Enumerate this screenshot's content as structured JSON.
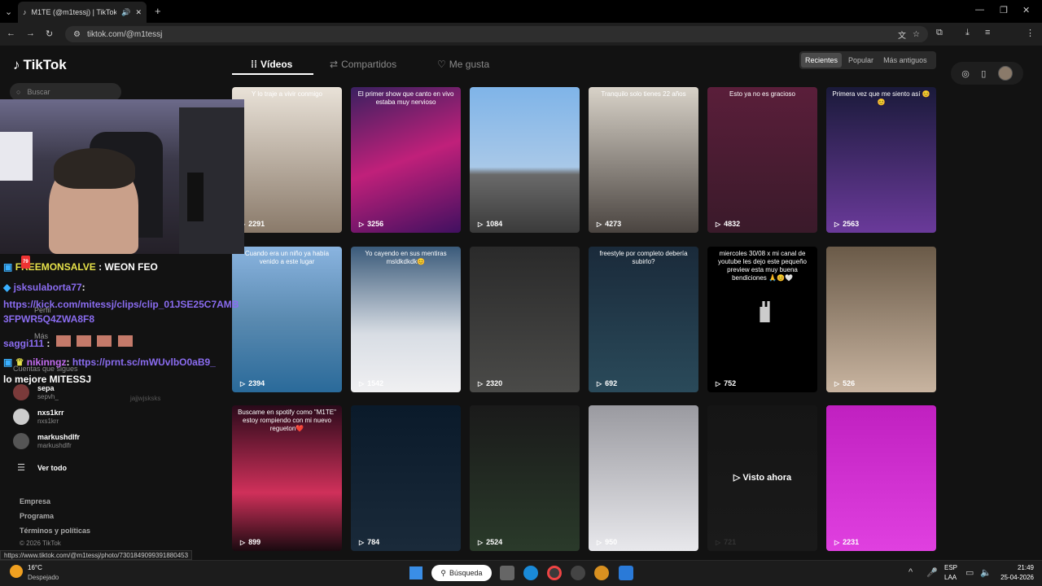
{
  "browser": {
    "tab_title": "M1TE (@m1tessj) | TikTok",
    "url": "tiktok.com/@m1tessj"
  },
  "tiktok": {
    "logo": "TikTok",
    "search_placeholder": "Buscar",
    "tabs": [
      "Vídeos",
      "Compartidos",
      "Me gusta"
    ],
    "sort": [
      "Recientes",
      "Popular",
      "Más antiguos"
    ],
    "avatar_letter": "M"
  },
  "videos": [
    {
      "caption": "Y lo traje a vivir conmigo",
      "views": "2291"
    },
    {
      "caption": "El primer show que canto en vivo estaba muy nervioso",
      "views": "3256"
    },
    {
      "caption": "",
      "views": "1084"
    },
    {
      "caption": "Tranquilo solo tienes 22 años",
      "views": "4273"
    },
    {
      "caption": "Esto ya no es gracioso",
      "views": "4832"
    },
    {
      "caption": "Primera vez que me siento así 😊😊",
      "views": "2563"
    },
    {
      "caption": "Cuando era un niño ya había venido a este lugar",
      "views": "2394"
    },
    {
      "caption": "Yo cayendo en sus mentiras msldkdkdk😊",
      "views": "1542"
    },
    {
      "caption": "",
      "views": "2320"
    },
    {
      "caption": "freestyle por completo debería subirlo?",
      "views": "692"
    },
    {
      "caption": "miercoles 30/08 x mi canal de youtube les dejo este pequeño preview esta muy buena bendiciones 🙏😊🤍",
      "views": "752"
    },
    {
      "caption": "",
      "views": "526"
    },
    {
      "caption": "Buscame en spotify como \"M1TE\" estoy rompiendo con mi nuevo regueton❤️",
      "views": "899"
    },
    {
      "caption": "",
      "views": "784"
    },
    {
      "caption": "",
      "views": "2524"
    },
    {
      "caption": "",
      "views": "950"
    },
    {
      "caption": "Visto ahora",
      "views": "721"
    },
    {
      "caption": "",
      "views": "2231"
    }
  ],
  "chat": {
    "line1_user": "FREEMONSALVE",
    "line1_msg": ": WEON FEO",
    "line2_user": "jsksulaborta77",
    "line2_link": "https://kick.com/mitessj/clips/clip_01JSE25C7AMB3FPWR5Q4ZWA8F8",
    "line3_user": "saggi111",
    "line4_user": "nikinngz",
    "line4_link": "https://prnt.sc/mWUvlbO0aB9_",
    "line5": "lo mejore MITESSJ",
    "badge_count": "79"
  },
  "sidebar": {
    "profile": "Perfil",
    "more": "Más",
    "following_title": "Cuentas que sigues",
    "accounts": [
      {
        "name": "sepa",
        "handle": "sepvh_"
      },
      {
        "name": "nxs1krr",
        "handle": "nxs1krr"
      },
      {
        "name": "markushdlfr",
        "handle": "markushdlfr"
      }
    ],
    "see_all": "Ver todo",
    "footer": [
      "Empresa",
      "Programa",
      "Términos y políticas"
    ],
    "copyright": "© 2026 TikTok",
    "ghost": "jajjwjsksks"
  },
  "status_url": "https://www.tiktok.com/@m1tessj/photo/7301849099391880453",
  "taskbar": {
    "weather_temp": "16°C",
    "weather_desc": "Despejado",
    "search": "Búsqueda",
    "lang1": "ESP",
    "lang2": "LAA",
    "time": "21:49",
    "date": "25-04-2026"
  }
}
